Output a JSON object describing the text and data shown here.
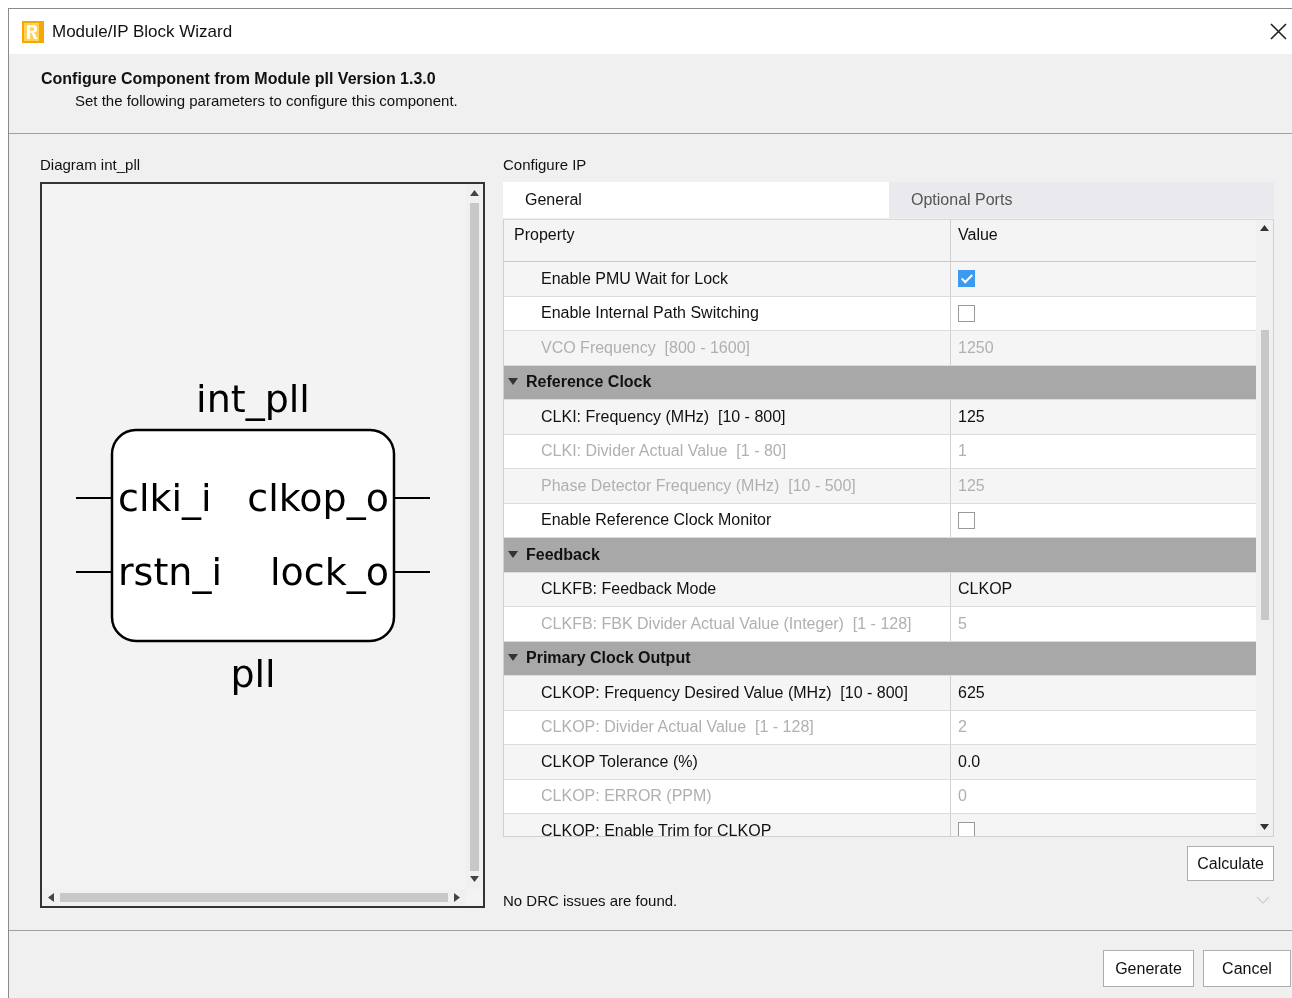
{
  "window": {
    "title": "Module/IP Block Wizard"
  },
  "header": {
    "title": "Configure Component from Module pll Version 1.3.0",
    "subtitle": "Set the following parameters to configure this component."
  },
  "diagram": {
    "label": "Diagram int_pll",
    "instance": "int_pll",
    "module": "pll",
    "inputs": [
      "clki_i",
      "rstn_i"
    ],
    "outputs": [
      "clkop_o",
      "lock_o"
    ]
  },
  "configure": {
    "label": "Configure IP",
    "tabs": [
      {
        "label": "General",
        "selected": true
      },
      {
        "label": "Optional Ports",
        "selected": false
      }
    ],
    "columns": [
      "Property",
      "Value"
    ],
    "rows": [
      {
        "kind": "checkbox",
        "label": "Enable PMU Wait for Lock",
        "checked": true,
        "disabled": false
      },
      {
        "kind": "checkbox",
        "label": "Enable Internal Path Switching",
        "checked": false,
        "disabled": false
      },
      {
        "kind": "value",
        "label": "VCO Frequency  [800 - 1600]",
        "value": "1250",
        "disabled": true
      },
      {
        "kind": "section",
        "label": "Reference Clock",
        "expanded": true
      },
      {
        "kind": "value",
        "label": "CLKI: Frequency (MHz)  [10 - 800]",
        "value": "125",
        "disabled": false
      },
      {
        "kind": "value",
        "label": "CLKI: Divider Actual Value  [1 - 80]",
        "value": "1",
        "disabled": true
      },
      {
        "kind": "value",
        "label": "Phase Detector Frequency (MHz)  [10 - 500]",
        "value": "125",
        "disabled": true
      },
      {
        "kind": "checkbox",
        "label": "Enable Reference Clock Monitor",
        "checked": false,
        "disabled": false
      },
      {
        "kind": "section",
        "label": "Feedback",
        "expanded": true
      },
      {
        "kind": "value",
        "label": "CLKFB: Feedback Mode",
        "value": "CLKOP",
        "disabled": false
      },
      {
        "kind": "value",
        "label": "CLKFB: FBK Divider Actual Value (Integer)  [1 - 128]",
        "value": "5",
        "disabled": true
      },
      {
        "kind": "section",
        "label": "Primary Clock Output",
        "expanded": true
      },
      {
        "kind": "value",
        "label": "CLKOP: Frequency Desired Value (MHz)  [10 - 800]",
        "value": "625",
        "disabled": false
      },
      {
        "kind": "value",
        "label": "CLKOP: Divider Actual Value  [1 - 128]",
        "value": "2",
        "disabled": true
      },
      {
        "kind": "value",
        "label": "CLKOP Tolerance (%)",
        "value": "0.0",
        "disabled": false
      },
      {
        "kind": "value",
        "label": "CLKOP: ERROR (PPM)",
        "value": "0",
        "disabled": true
      },
      {
        "kind": "checkbox",
        "label": "CLKOP: Enable Trim for CLKOP",
        "checked": false,
        "disabled": false
      }
    ],
    "calculate": "Calculate",
    "status": "No DRC issues are found."
  },
  "buttons": [
    "Generate",
    "Cancel"
  ]
}
